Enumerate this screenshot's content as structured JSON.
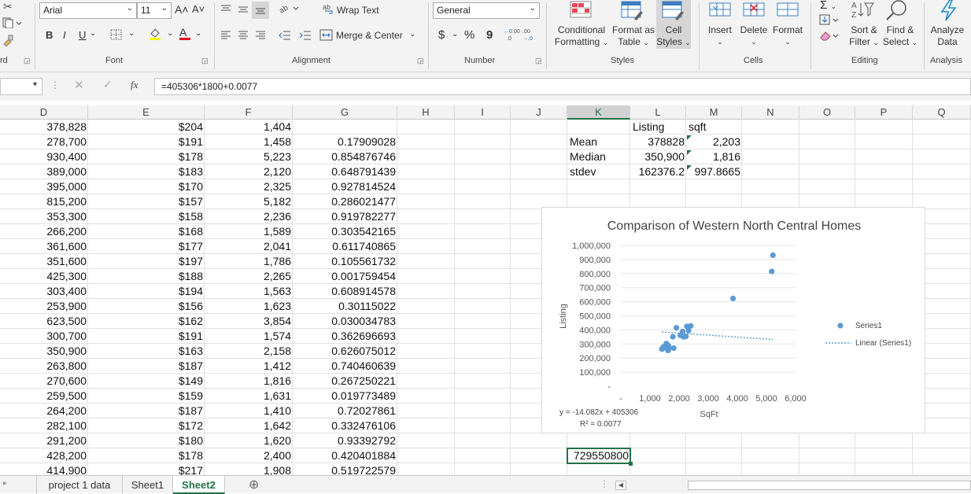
{
  "ribbon": {
    "font_name": "Arial",
    "font_size": "11",
    "number_format": "General",
    "wrap_text": "Wrap Text",
    "merge_center": "Merge & Center",
    "currency": "$",
    "percent": "%",
    "comma": "9",
    "conditional_formatting": [
      "Conditional",
      "Formatting"
    ],
    "format_as_table": [
      "Format as",
      "Table"
    ],
    "cell_styles": [
      "Cell",
      "Styles"
    ],
    "insert": "Insert",
    "delete": "Delete",
    "format": "Format",
    "sort_filter": [
      "Sort &",
      "Filter"
    ],
    "find_select": [
      "Find &",
      "Select"
    ],
    "analyze_data": [
      "Analyze",
      "Data"
    ],
    "bold": "B",
    "italic": "I",
    "underline": "U",
    "increase_font": "A˄",
    "decrease_font": "A˅",
    "groups": {
      "clipboard": "rd",
      "font": "Font",
      "alignment": "Alignment",
      "number": "Number",
      "styles": "Styles",
      "cells": "Cells",
      "editing": "Editing",
      "analysis": "Analysis"
    },
    "colors": {
      "accent": "#217346",
      "fill_yellow": "#ffff00",
      "font_red": "#e81123",
      "lightning": "#1e8bcd"
    }
  },
  "formula_bar": {
    "formula": "=405306*1800+0.0077",
    "fx": "fx"
  },
  "columns": [
    "D",
    "E",
    "F",
    "G",
    "H",
    "I",
    "J",
    "K",
    "L",
    "M",
    "N",
    "O",
    "P",
    "Q"
  ],
  "active_column": "K",
  "rows": [
    {
      "d": "378,828",
      "e": "$204",
      "f": "1,404",
      "g": ""
    },
    {
      "d": "278,700",
      "e": "$191",
      "f": "1,458",
      "g": "0.17909028"
    },
    {
      "d": "930,400",
      "e": "$178",
      "f": "5,223",
      "g": "0.854876746"
    },
    {
      "d": "389,000",
      "e": "$183",
      "f": "2,120",
      "g": "0.648791439"
    },
    {
      "d": "395,000",
      "e": "$170",
      "f": "2,325",
      "g": "0.927814524"
    },
    {
      "d": "815,200",
      "e": "$157",
      "f": "5,182",
      "g": "0.286021477"
    },
    {
      "d": "353,300",
      "e": "$158",
      "f": "2,236",
      "g": "0.919782277"
    },
    {
      "d": "266,200",
      "e": "$168",
      "f": "1,589",
      "g": "0.303542165"
    },
    {
      "d": "361,600",
      "e": "$177",
      "f": "2,041",
      "g": "0.611740865"
    },
    {
      "d": "351,600",
      "e": "$197",
      "f": "1,786",
      "g": "0.105561732"
    },
    {
      "d": "425,300",
      "e": "$188",
      "f": "2,265",
      "g": "0.001759454"
    },
    {
      "d": "303,400",
      "e": "$194",
      "f": "1,563",
      "g": "0.608914578"
    },
    {
      "d": "253,900",
      "e": "$156",
      "f": "1,623",
      "g": "0.30115022"
    },
    {
      "d": "623,500",
      "e": "$162",
      "f": "3,854",
      "g": "0.030034783"
    },
    {
      "d": "300,700",
      "e": "$191",
      "f": "1,574",
      "g": "0.362696693"
    },
    {
      "d": "350,900",
      "e": "$163",
      "f": "2,158",
      "g": "0.626075012"
    },
    {
      "d": "263,800",
      "e": "$187",
      "f": "1,412",
      "g": "0.740460639"
    },
    {
      "d": "270,600",
      "e": "$149",
      "f": "1,816",
      "g": "0.267250221"
    },
    {
      "d": "259,500",
      "e": "$159",
      "f": "1,631",
      "g": "0.019773489"
    },
    {
      "d": "264,200",
      "e": "$187",
      "f": "1,410",
      "g": "0.72027861"
    },
    {
      "d": "282,100",
      "e": "$172",
      "f": "1,642",
      "g": "0.332476106"
    },
    {
      "d": "291,200",
      "e": "$180",
      "f": "1,620",
      "g": "0.93392792"
    },
    {
      "d": "428,200",
      "e": "$178",
      "f": "2,400",
      "g": "0.420401884"
    },
    {
      "d": "414,900",
      "e": "$217",
      "f": "1,908",
      "g": "0.519722579"
    }
  ],
  "stats": {
    "headers": {
      "l": "Listing",
      "m": "sqft"
    },
    "mean": {
      "label": "Mean",
      "l": "378828",
      "m": "2,203"
    },
    "median": {
      "label": "Median",
      "l": "350,900",
      "m": "1,816"
    },
    "stdev": {
      "label": "stdev",
      "l": "162376.2",
      "m": "997.8665"
    },
    "result": "729550800"
  },
  "sheet_tabs": [
    "project 1 data",
    "Sheet1",
    "Sheet2"
  ],
  "active_tab": "Sheet2",
  "chart_data": {
    "type": "scatter",
    "title": "Comparison of Western North Central Homes",
    "xlabel": "SqFt",
    "ylabel": "Listing",
    "xlim": [
      0,
      6000
    ],
    "ylim": [
      0,
      1000000
    ],
    "x_ticks": [
      "-",
      "1,000",
      "2,000",
      "3,000",
      "4,000",
      "5,000",
      "6,000"
    ],
    "y_ticks": [
      "-",
      "100,000",
      "200,000",
      "300,000",
      "400,000",
      "500,000",
      "600,000",
      "700,000",
      "800,000",
      "900,000",
      "1,000,000"
    ],
    "series": [
      {
        "name": "Series1",
        "color": "#5b9bd5",
        "points": [
          [
            1458,
            278700
          ],
          [
            5223,
            930400
          ],
          [
            2120,
            389000
          ],
          [
            2325,
            395000
          ],
          [
            5182,
            815200
          ],
          [
            2236,
            353300
          ],
          [
            1589,
            266200
          ],
          [
            2041,
            361600
          ],
          [
            1786,
            351600
          ],
          [
            2265,
            425300
          ],
          [
            1563,
            303400
          ],
          [
            1623,
            253900
          ],
          [
            3854,
            623500
          ],
          [
            1574,
            300700
          ],
          [
            2158,
            350900
          ],
          [
            1412,
            263800
          ],
          [
            1816,
            270600
          ],
          [
            1631,
            259500
          ],
          [
            1410,
            264200
          ],
          [
            1642,
            282100
          ],
          [
            1620,
            291200
          ],
          [
            2400,
            428200
          ],
          [
            1908,
            414900
          ]
        ]
      }
    ],
    "trendline": {
      "name": "Linear (Series1)",
      "slope": -14.082,
      "intercept": 405306,
      "color": "#5b9bd5"
    },
    "equation": "y = -14.082x + 405306",
    "r_squared": "R² = 0.0077",
    "legend_position": "right"
  }
}
